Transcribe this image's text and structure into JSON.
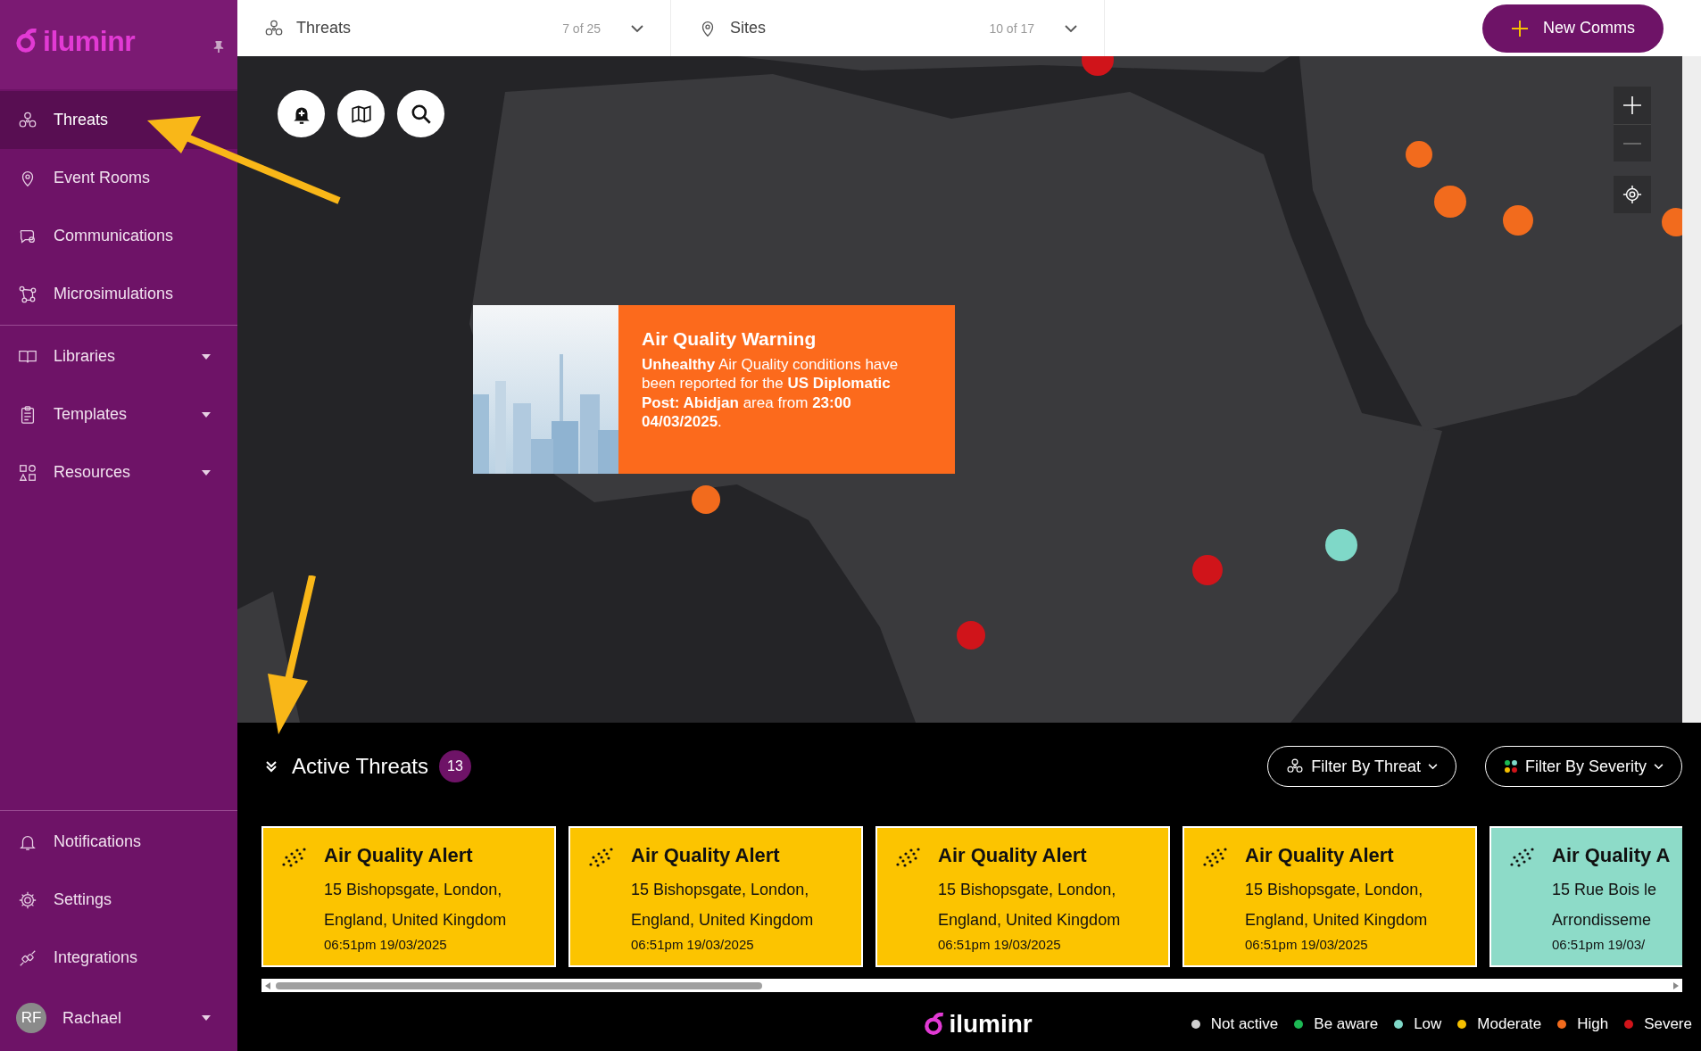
{
  "sidebar": {
    "logo": "iluminr",
    "sections": [
      {
        "items": [
          {
            "label": "Threats",
            "selected": true,
            "dropdown": false
          },
          {
            "label": "Event Rooms",
            "selected": false,
            "dropdown": false
          },
          {
            "label": "Communications",
            "selected": false,
            "dropdown": false
          },
          {
            "label": "Microsimulations",
            "selected": false,
            "dropdown": false
          }
        ]
      },
      {
        "items": [
          {
            "label": "Libraries",
            "selected": false,
            "dropdown": true
          },
          {
            "label": "Templates",
            "selected": false,
            "dropdown": true
          },
          {
            "label": "Resources",
            "selected": false,
            "dropdown": true
          }
        ]
      }
    ],
    "footer_items": [
      {
        "label": "Notifications",
        "selected": false
      },
      {
        "label": "Settings",
        "selected": false
      },
      {
        "label": "Integrations",
        "selected": false
      }
    ],
    "user": {
      "initials": "RF",
      "name": "Rachael"
    }
  },
  "topbar": {
    "filters": [
      {
        "label": "Threats",
        "count": "7 of 25"
      },
      {
        "label": "Sites",
        "count": "10 of 17"
      }
    ],
    "new_button": "New Comms"
  },
  "map": {
    "popup": {
      "title": "Air Quality Warning",
      "body": "**Unhealthy** Air Quality conditions have been reported for the **US Diplomatic Post: Abidjan** area from **23:00 04/03/2025**."
    }
  },
  "active_threats": {
    "title": "Active Threats",
    "count": "13",
    "filters": [
      "Filter By Threat",
      "Filter By Severity"
    ],
    "cards": [
      {
        "title": "Air Quality Alert",
        "address_1": "15 Bishopsgate, London,",
        "address_2": "England, United Kingdom",
        "time": "06:51pm 19/03/2025",
        "color": "#fcc400"
      },
      {
        "title": "Air Quality Alert",
        "address_1": "15 Bishopsgate, London,",
        "address_2": "England, United Kingdom",
        "time": "06:51pm 19/03/2025",
        "color": "#fcc400"
      },
      {
        "title": "Air Quality Alert",
        "address_1": "15 Bishopsgate, London,",
        "address_2": "England, United Kingdom",
        "time": "06:51pm 19/03/2025",
        "color": "#fcc400"
      },
      {
        "title": "Air Quality Alert",
        "address_1": "15 Bishopsgate, London,",
        "address_2": "England, United Kingdom",
        "time": "06:51pm 19/03/2025",
        "color": "#fcc400"
      },
      {
        "title": "Air Quality A",
        "address_1": "15 Rue Bois le",
        "address_2": "Arrondisseme",
        "time": "06:51pm 19/03/",
        "color": "#8ddbc8"
      }
    ]
  },
  "footer": {
    "logo": "iluminr",
    "legend": [
      {
        "label": "Not active",
        "color": "#d0d0d0"
      },
      {
        "label": "Be aware",
        "color": "#1db954"
      },
      {
        "label": "Low",
        "color": "#7fd8c8"
      },
      {
        "label": "Moderate",
        "color": "#f5c000"
      },
      {
        "label": "High",
        "color": "#f26b1d"
      },
      {
        "label": "Severe",
        "color": "#d0141a"
      }
    ]
  }
}
